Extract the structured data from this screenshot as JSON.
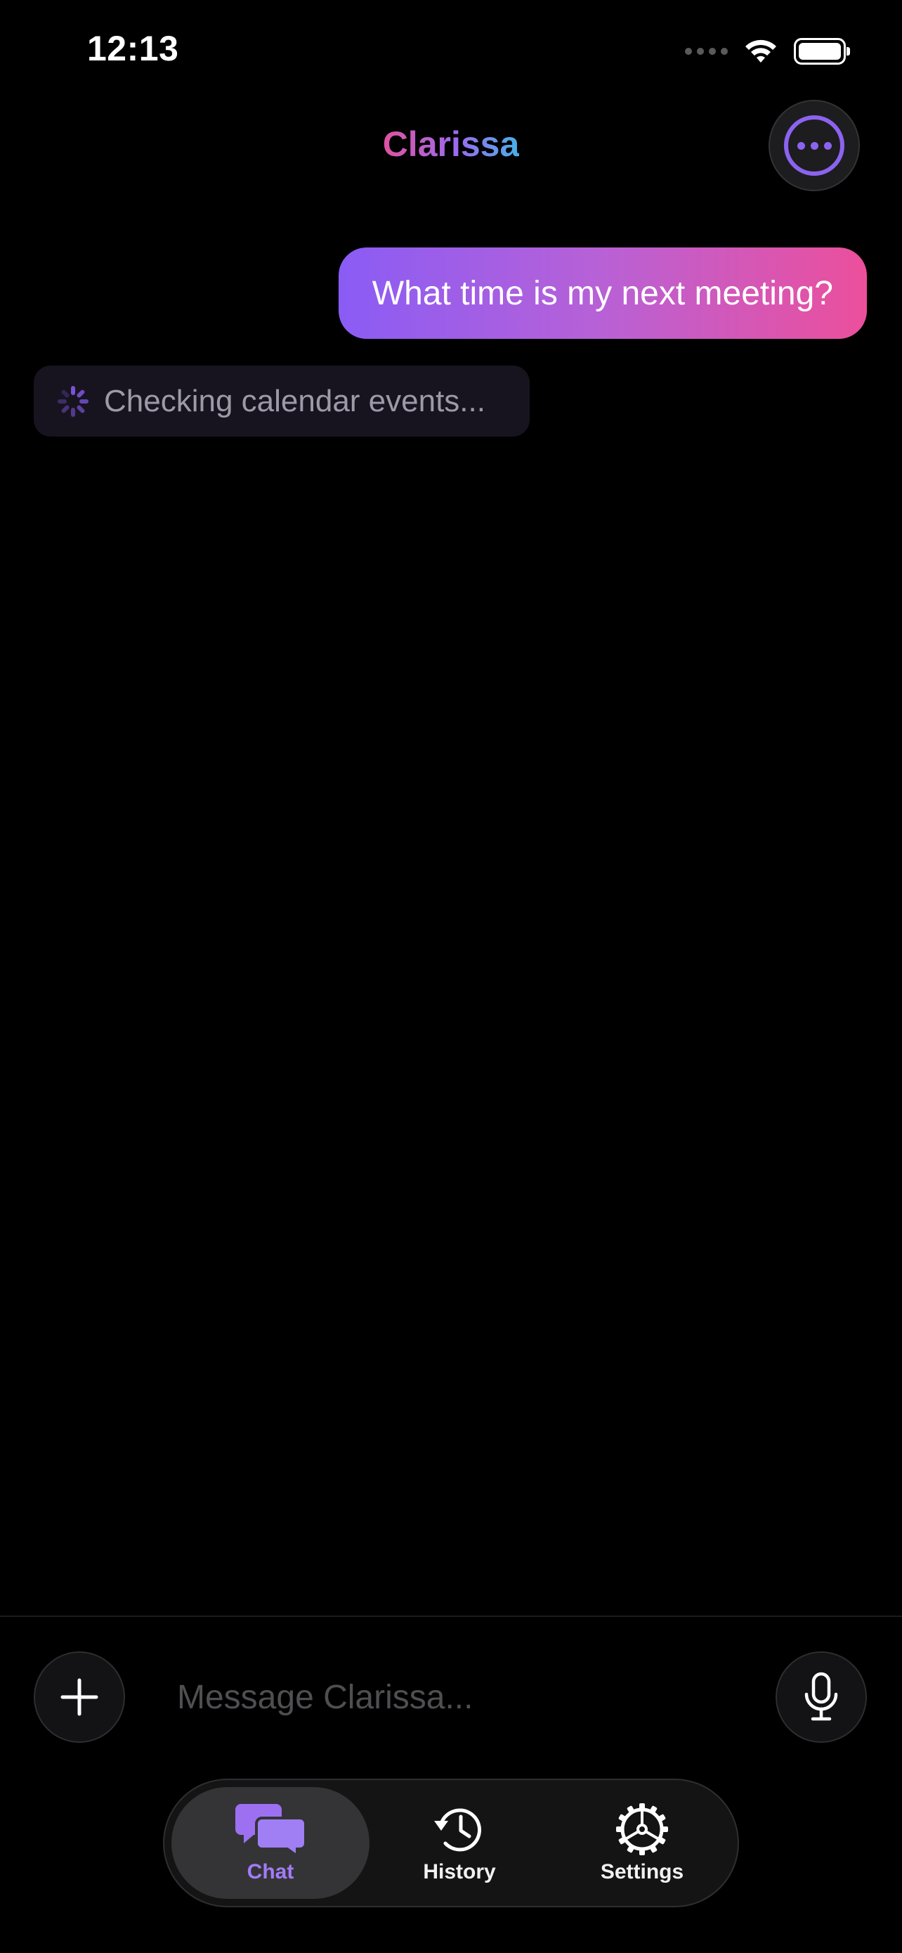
{
  "status_bar": {
    "time": "12:13"
  },
  "header": {
    "title": "Clarissa"
  },
  "messages": {
    "user": "What time is my next meeting?",
    "assistant_status": "Checking calendar events..."
  },
  "composer": {
    "placeholder": "Message Clarissa..."
  },
  "tabs": [
    {
      "label": "Chat",
      "icon": "chat-bubbles-icon",
      "selected": true
    },
    {
      "label": "History",
      "icon": "history-icon",
      "selected": false
    },
    {
      "label": "Settings",
      "icon": "gear-icon",
      "selected": false
    }
  ],
  "colors": {
    "accent": "#8c63f0",
    "user_bubble_start": "#8a5cf5",
    "user_bubble_end": "#ec4f9b",
    "background": "#000000"
  }
}
